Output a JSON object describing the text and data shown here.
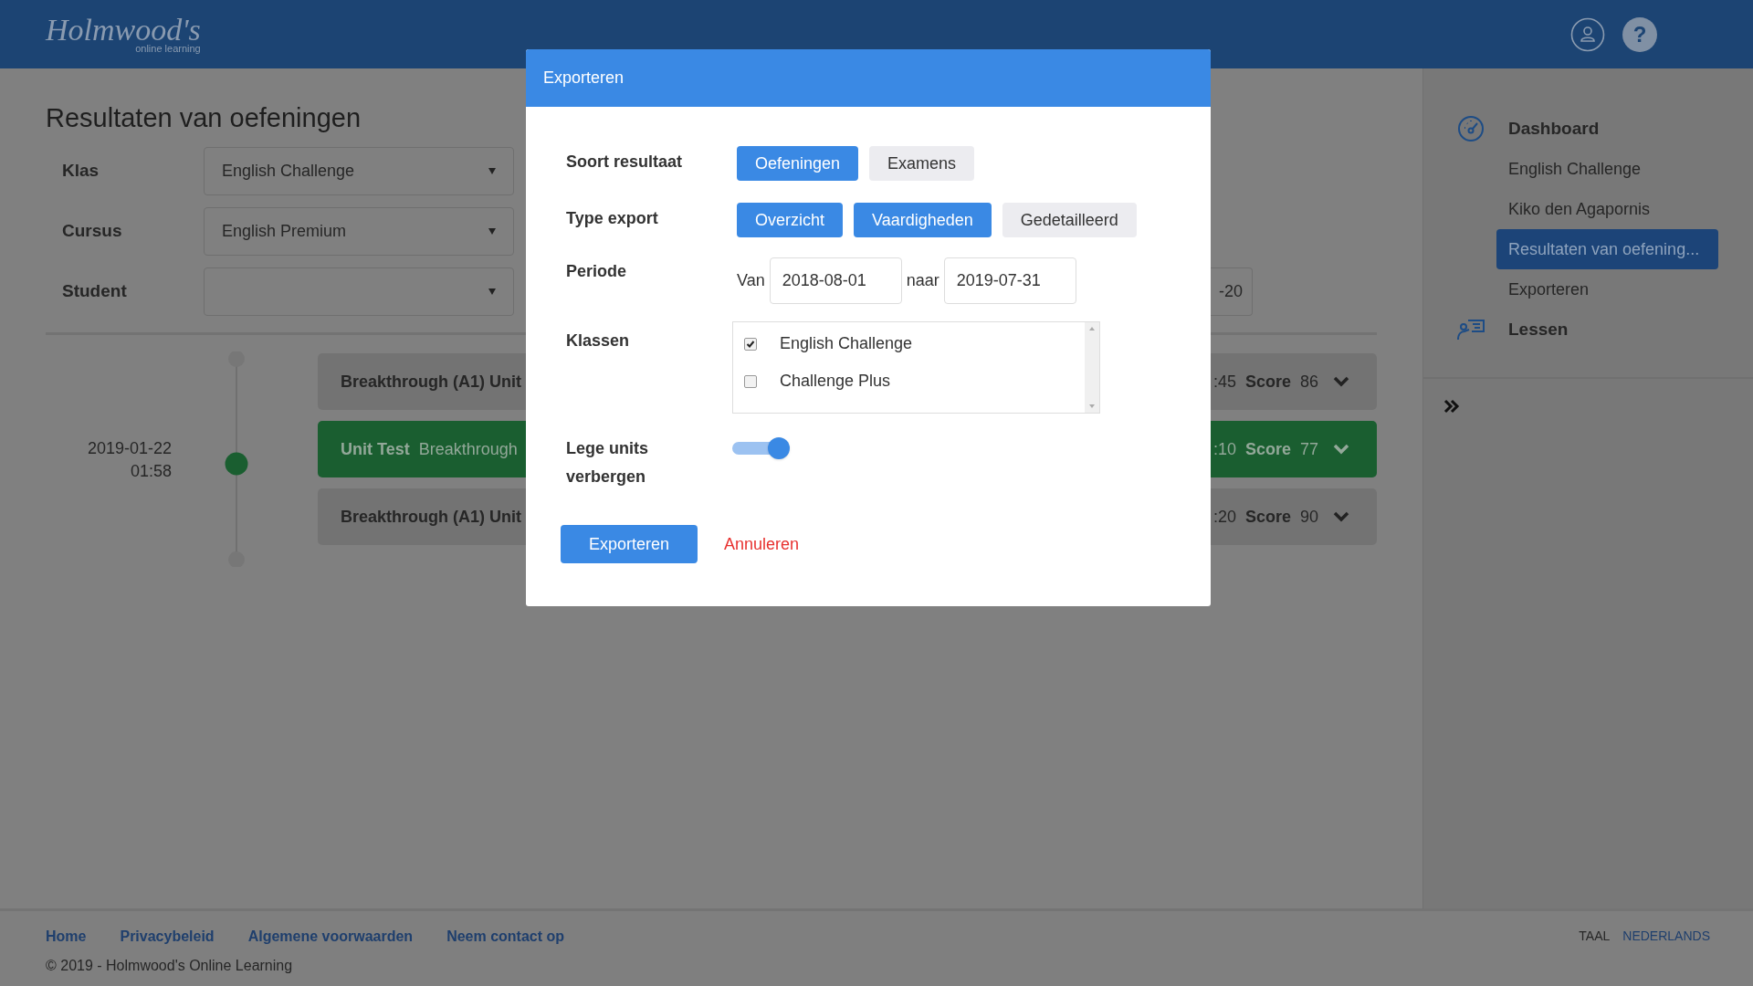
{
  "header": {
    "logo": "Holmwood's",
    "tagline": "online learning",
    "help_button": "?"
  },
  "page": {
    "title": "Resultaten van oefeningen",
    "filters": [
      {
        "label": "Klas",
        "value": "English Challenge"
      },
      {
        "label": "Cursus",
        "value": "English Premium"
      },
      {
        "label": "Student"
      }
    ],
    "date_field_fragment": "-20"
  },
  "timeline": {
    "date": "2019-01-22",
    "time": "01:58",
    "entries": [
      {
        "selected": false,
        "title": "Breakthrough (A1) Unit",
        "time_fragment": ":45",
        "score_label": "Score",
        "score": "86"
      },
      {
        "selected": true,
        "title": "Unit Test",
        "subtitle": "Breakthrough",
        "time_fragment": ":10",
        "score_label": "Score",
        "score": "77"
      },
      {
        "selected": false,
        "title": "Breakthrough (A1) Unit",
        "time_fragment": ":20",
        "score_label": "Score",
        "score": "90"
      }
    ]
  },
  "dialog": {
    "title": "Exporteren",
    "result_type": {
      "label": "Soort resultaat",
      "options": [
        {
          "label": "Oefeningen",
          "selected": true
        },
        {
          "label": "Examens",
          "selected": false
        }
      ]
    },
    "export_type": {
      "label": "Type export",
      "options": [
        {
          "label": "Overzicht",
          "selected": true
        },
        {
          "label": "Vaardigheden",
          "selected": true
        },
        {
          "label": "Gedetailleerd",
          "selected": false
        }
      ]
    },
    "period": {
      "label": "Periode",
      "from_label": "Van",
      "from": "2018-08-01",
      "to_label": "naar",
      "to": "2019-07-31"
    },
    "classes": {
      "label": "Klassen",
      "items": [
        {
          "label": "English Challenge",
          "checked": true
        },
        {
          "label": "Challenge Plus",
          "checked": false
        }
      ]
    },
    "hide_empty": {
      "label": "Lege units verbergen",
      "on": true
    },
    "export_button": "Exporteren",
    "cancel_button": "Annuleren"
  },
  "sidebar": {
    "items": [
      {
        "label": "Dashboard",
        "children": [
          {
            "label": "English Challenge",
            "selected": false
          },
          {
            "label": "Kiko den Agapornis",
            "selected": false
          },
          {
            "label": "Resultaten van oefening...",
            "selected": true
          },
          {
            "label": "Exporteren",
            "selected": false
          }
        ]
      },
      {
        "label": "Lessen"
      }
    ]
  },
  "footer": {
    "links": [
      "Home",
      "Privacybeleid",
      "Algemene voorwaarden",
      "Neem contact op"
    ],
    "copyright": "© 2019 - Holmwood's Online Learning",
    "language_label": "TAAL",
    "language": "NEDERLANDS"
  }
}
